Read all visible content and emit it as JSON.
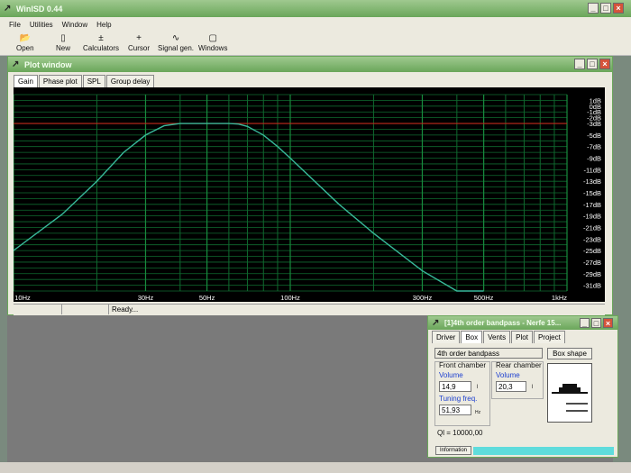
{
  "app": {
    "title": "WinISD 0.44"
  },
  "menu": [
    "File",
    "Utilities",
    "Window",
    "Help"
  ],
  "toolbar": [
    {
      "label": "Open",
      "icon": "folder-open-icon"
    },
    {
      "label": "New",
      "icon": "new-document-icon"
    },
    {
      "label": "Calculators",
      "icon": "calculator-icon"
    },
    {
      "label": "Cursor",
      "icon": "crosshair-icon"
    },
    {
      "label": "Signal gen.",
      "icon": "signal-generator-icon"
    },
    {
      "label": "Windows",
      "icon": "windows-icon"
    }
  ],
  "plot_window": {
    "title": "Plot window",
    "tabs": [
      "Gain",
      "Phase plot",
      "SPL",
      "Group delay"
    ],
    "active_tab": "Gain",
    "status": "Ready..."
  },
  "chart_data": {
    "type": "line",
    "x_scale": "log",
    "xlim": [
      10,
      1000
    ],
    "ylim": [
      -32,
      2
    ],
    "x_ticks": [
      {
        "v": 10,
        "label": "10Hz"
      },
      {
        "v": 30,
        "label": "30Hz"
      },
      {
        "v": 50,
        "label": "50Hz"
      },
      {
        "v": 100,
        "label": "100Hz"
      },
      {
        "v": 300,
        "label": "300Hz"
      },
      {
        "v": 500,
        "label": "500Hz"
      },
      {
        "v": 1000,
        "label": "1kHz"
      }
    ],
    "y_ticks": [
      {
        "v": 1,
        "label": "1dB"
      },
      {
        "v": 0,
        "label": "0dB"
      },
      {
        "v": -1,
        "label": "-1dB"
      },
      {
        "v": -2,
        "label": "-2dB"
      },
      {
        "v": -3,
        "label": "-3dB"
      },
      {
        "v": -5,
        "label": "-5dB"
      },
      {
        "v": -7,
        "label": "-7dB"
      },
      {
        "v": -9,
        "label": "-9dB"
      },
      {
        "v": -11,
        "label": "-11dB"
      },
      {
        "v": -13,
        "label": "-13dB"
      },
      {
        "v": -15,
        "label": "-15dB"
      },
      {
        "v": -17,
        "label": "-17dB"
      },
      {
        "v": -19,
        "label": "-19dB"
      },
      {
        "v": -21,
        "label": "-21dB"
      },
      {
        "v": -23,
        "label": "-23dB"
      },
      {
        "v": -25,
        "label": "-25dB"
      },
      {
        "v": -27,
        "label": "-27dB"
      },
      {
        "v": -29,
        "label": "-29dB"
      },
      {
        "v": -31,
        "label": "-31dB"
      }
    ],
    "reference_line_db": -3,
    "series": [
      {
        "color": "#38b89a",
        "x": [
          10,
          15,
          20,
          25,
          30,
          35,
          40,
          45,
          50,
          55,
          60,
          65,
          70,
          80,
          90,
          100,
          150,
          200,
          300,
          400,
          500
        ],
        "y": [
          -25.0,
          -18.7,
          -13.0,
          -8.0,
          -5.0,
          -3.4,
          -3.0,
          -3.0,
          -3.0,
          -3.0,
          -3.0,
          -3.1,
          -3.5,
          -5.0,
          -7.0,
          -9.0,
          -17.0,
          -22.0,
          -28.5,
          -32.5,
          -35.0
        ]
      }
    ],
    "colors": {
      "grid_minor": "#0f6a2f",
      "grid_major": "#178a3d",
      "reference": "#c02b1d",
      "tick_text": "#ffffff"
    }
  },
  "box_window": {
    "title": "[1]4th order bandpass - Nerfe 15...",
    "tabs": [
      "Driver",
      "Box",
      "Vents",
      "Plot",
      "Project"
    ],
    "active_tab": "Box",
    "box_type": "4th order bandpass",
    "box_shape_button": "Box shape",
    "front_chamber": {
      "title": "Front chamber",
      "volume_label": "Volume",
      "volume_value": "14,9",
      "volume_unit": "l",
      "tuning_label": "Tuning freq.",
      "tuning_value": "51,93",
      "tuning_unit": "Hz"
    },
    "rear_chamber": {
      "title": "Rear chamber",
      "volume_label": "Volume",
      "volume_value": "20,3",
      "volume_unit": "l"
    },
    "ql": "Ql = 10000,00",
    "info_button": "Information"
  }
}
